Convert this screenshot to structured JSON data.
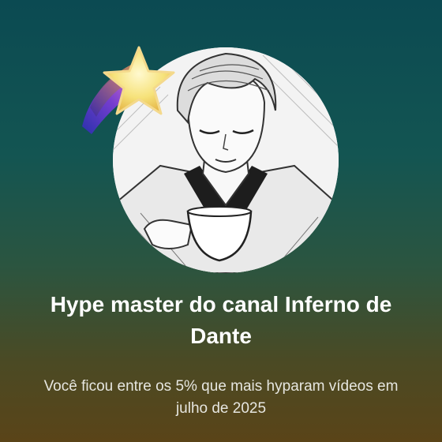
{
  "card": {
    "title": "Hype master do canal Inferno de Dante",
    "subtitle": "Você ficou entre os 5% que mais hyparam vídeos em julho de 2025"
  },
  "colors": {
    "background_top": "#0b4a52",
    "background_bottom": "#5a4418",
    "star_fill": "#f6e27a",
    "star_trail": "#6a3cc8"
  },
  "icons": {
    "badge": "hype-star-icon",
    "avatar": "channel-avatar"
  }
}
